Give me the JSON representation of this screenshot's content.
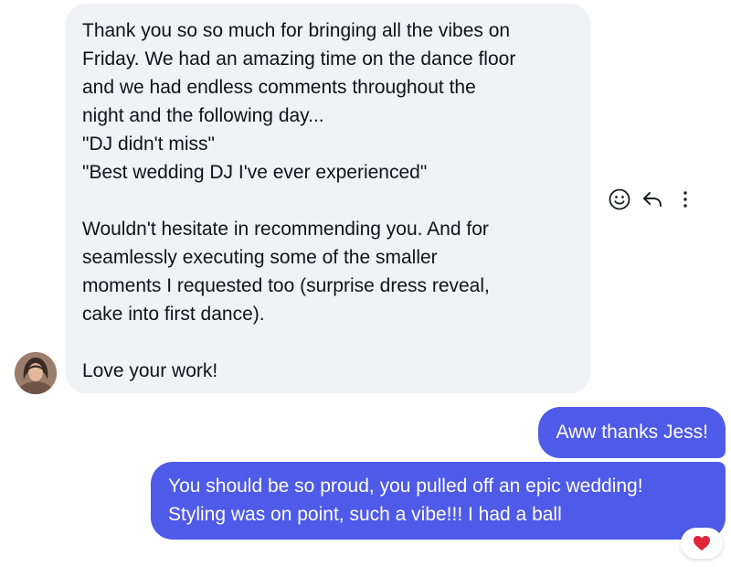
{
  "colors": {
    "incoming_bubble": "#f0f2f5",
    "outgoing_bubble": "#4e5ae8",
    "incoming_text": "#111318",
    "outgoing_text": "#ffffff",
    "reaction_heart": "#e0243a"
  },
  "incoming_message": {
    "lines": [
      "Thank you so so much for bringing all the vibes on",
      "Friday. We had an amazing time on the dance floor",
      "and we had endless comments throughout the",
      "night and the following day...",
      "\"DJ didn't miss\"",
      "\"Best wedding DJ I've ever experienced\"",
      "",
      "Wouldn't hesitate in recommending you. And for",
      "seamlessly executing some of the smaller",
      "moments I requested too (surprise dress reveal,",
      "cake into first dance).",
      "",
      "Love your work!"
    ]
  },
  "message_actions": {
    "icons": [
      "emoji-react-icon",
      "reply-icon",
      "more-options-icon"
    ]
  },
  "outgoing_messages": [
    {
      "lines": [
        "Aww thanks Jess!"
      ]
    },
    {
      "lines": [
        "You should be so proud, you pulled off an epic wedding!",
        "Styling was on point, such a vibe!!! I had a ball"
      ],
      "reaction": "heart-icon"
    }
  ]
}
